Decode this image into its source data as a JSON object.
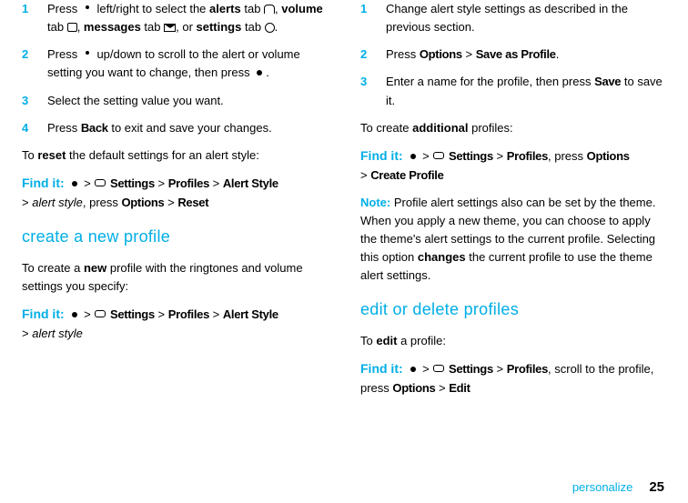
{
  "left": {
    "s1a": "Press ",
    "s1b": " left/right to select the ",
    "s1c": "alerts",
    "s1d": " tab ",
    "s1e": ", ",
    "s1f": "volume",
    "s1g": " tab ",
    "s1h": ", ",
    "s1i": "messages",
    "s1j": " tab ",
    "s1k": ", or ",
    "s1l": "settings",
    "s1m": " tab ",
    "s1n": ".",
    "s2a": "Press ",
    "s2b": " up/down to scroll to the alert or volume setting you want to change, then press ",
    "s2c": ".",
    "s3": "Select the setting value you want.",
    "s4a": "Press ",
    "s4b": "Back",
    "s4c": " to exit and save your changes.",
    "reseta": "To ",
    "resetb": "reset",
    "resetc": " the default settings for an alert style:",
    "find1": "Find it: ",
    "gt": " > ",
    "settings": "Settings",
    "profiles": "Profiles",
    "alertstyle": "Alert Style",
    "as": "alert style",
    "press": ", press ",
    "options": "Options",
    "reset": "Reset",
    "h2a": "create a new profile",
    "newa": "To create a ",
    "newb": "new",
    "newc": " profile with the ringtones and volume settings you specify:"
  },
  "right": {
    "s1": "Change alert style settings as described in the previous section.",
    "s2a": "Press ",
    "s2b": "Options",
    "s2c": " > ",
    "s2d": "Save as Profile",
    "s2e": ".",
    "s3a": "Enter a name for the profile, then press ",
    "s3b": "Save",
    "s3c": " to save it.",
    "adda": "To create ",
    "addb": "additional",
    "addc": " profiles:",
    "find1": "Find it: ",
    "gt": " > ",
    "settings": "Settings",
    "profiles": "Profiles",
    "press": ", press ",
    "options": "Options",
    "create": "Create Profile",
    "note": "Note: ",
    "notetxt1": "Profile alert settings also can be set by the theme. When you apply a new theme, you can choose to apply the theme's alert settings to the current profile. Selecting this option ",
    "changes": "changes",
    "notetxt2": " the current profile to use the theme alert settings.",
    "h2b": "edit or delete profiles",
    "edita": "To ",
    "editb": "edit",
    "editc": " a profile:",
    "scroll": ", scroll to the profile, press ",
    "edit": "Edit"
  },
  "n1": "1",
  "n2": "2",
  "n3": "3",
  "n4": "4",
  "footer": {
    "label": "personalize",
    "page": "25"
  }
}
